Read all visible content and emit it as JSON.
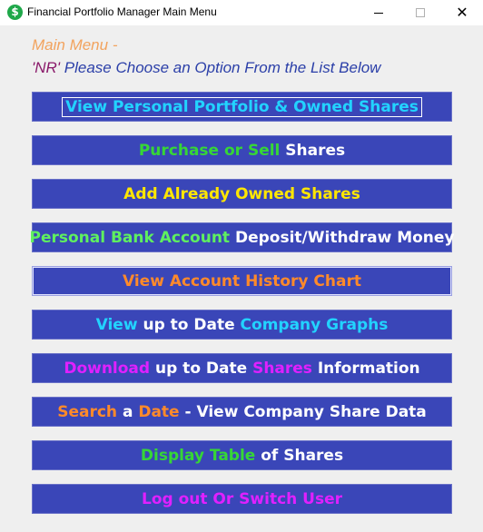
{
  "window": {
    "title": "Financial Portfolio Manager Main Menu",
    "icon": "dollar-icon"
  },
  "heading": {
    "line1": "Main Menu -",
    "user_code": "'NR'",
    "line2": " Please Choose an Option From the List Below"
  },
  "menu": [
    {
      "parts": [
        {
          "text": "View Personal Portfolio & Owned Shares",
          "color": "#22d3ff"
        }
      ]
    },
    {
      "parts": [
        {
          "text": "Purchase or Sell",
          "color": "#36d636"
        },
        {
          "text": " Shares",
          "color": "#ffffff"
        }
      ]
    },
    {
      "parts": [
        {
          "text": "Add Already Owned Shares",
          "color": "#ffe600"
        }
      ]
    },
    {
      "parts": [
        {
          "text": "Personal Bank Account",
          "color": "#5ff05f"
        },
        {
          "text": " Deposit/Withdraw Money",
          "color": "#ffffff"
        }
      ]
    },
    {
      "parts": [
        {
          "text": "View Account History Chart",
          "color": "#ff8a2a"
        }
      ]
    },
    {
      "parts": [
        {
          "text": "View",
          "color": "#22d3ff"
        },
        {
          "text": " up to Date ",
          "color": "#ffffff"
        },
        {
          "text": "Company Graphs",
          "color": "#22d3ff"
        }
      ]
    },
    {
      "parts": [
        {
          "text": "Download",
          "color": "#e020ff"
        },
        {
          "text": " up to Date ",
          "color": "#ffffff"
        },
        {
          "text": "Shares",
          "color": "#e020ff"
        },
        {
          "text": " Information",
          "color": "#ffffff"
        }
      ]
    },
    {
      "parts": [
        {
          "text": "Search",
          "color": "#ff8a2a"
        },
        {
          "text": " a ",
          "color": "#ffffff"
        },
        {
          "text": "Date",
          "color": "#ff8a2a"
        },
        {
          "text": " - View Company Share Data",
          "color": "#ffffff"
        }
      ]
    },
    {
      "parts": [
        {
          "text": "Display Table",
          "color": "#36d636"
        },
        {
          "text": " of Shares",
          "color": "#ffffff"
        }
      ]
    },
    {
      "parts": [
        {
          "text": "Log out Or Switch User",
          "color": "#e020ff"
        }
      ]
    }
  ]
}
